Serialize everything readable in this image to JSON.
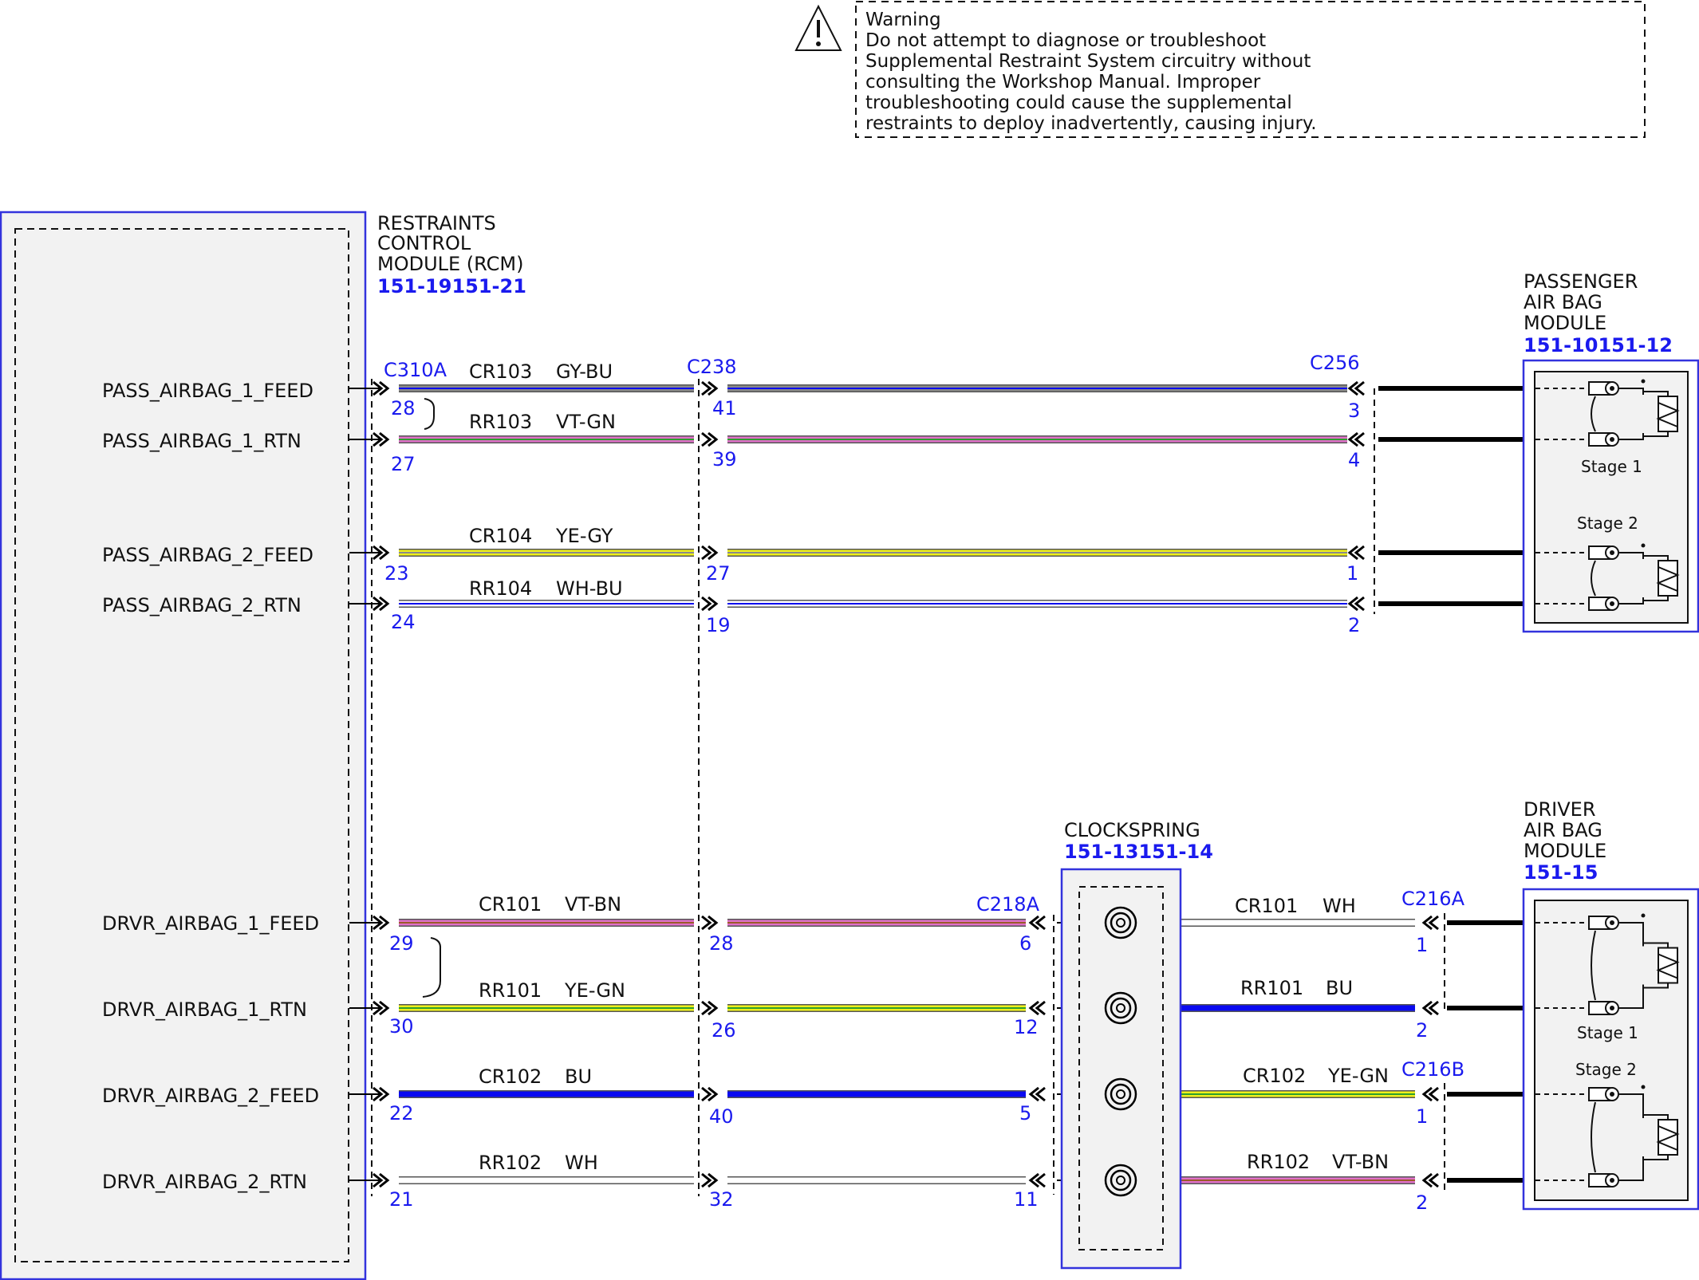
{
  "warning": {
    "title": "Warning",
    "lines": [
      "Do not attempt to diagnose or troubleshoot",
      "Supplemental Restraint System circuitry without",
      "consulting the Workshop Manual. Improper",
      "troubleshooting could cause the supplemental",
      "restraints to deploy inadvertently, causing injury."
    ],
    "icon": "warning-triangle-icon"
  },
  "rcm": {
    "name_lines": [
      "RESTRAINTS",
      "CONTROL",
      "MODULE (RCM)"
    ],
    "ref": "151-19151-21",
    "pins": [
      "PASS_AIRBAG_1_FEED",
      "PASS_AIRBAG_1_RTN",
      "PASS_AIRBAG_2_FEED",
      "PASS_AIRBAG_2_RTN",
      "DRVR_AIRBAG_1_FEED",
      "DRVR_AIRBAG_1_RTN",
      "DRVR_AIRBAG_2_FEED",
      "DRVR_AIRBAG_2_RTN"
    ]
  },
  "connectors": {
    "c310a": "C310A",
    "c238": "C238",
    "c256": "C256",
    "c218a": "C218A",
    "c216a": "C216A",
    "c216b": "C216B"
  },
  "circuits": [
    {
      "id": "CR103",
      "color": "GY-BU"
    },
    {
      "id": "RR103",
      "color": "VT-GN"
    },
    {
      "id": "CR104",
      "color": "YE-GY"
    },
    {
      "id": "RR104",
      "color": "WH-BU"
    },
    {
      "id": "CR101",
      "color": "VT-BN"
    },
    {
      "id": "RR101",
      "color": "YE-GN"
    },
    {
      "id": "CR102",
      "color": "BU"
    },
    {
      "id": "RR102",
      "color": "WH"
    }
  ],
  "clockspring_side": [
    "WH",
    "BU",
    "YE-GN",
    "VT-BN"
  ],
  "pins": [
    "28",
    "41",
    "3",
    "27",
    "39",
    "4",
    "23",
    "27",
    "1",
    "24",
    "19",
    "2",
    "29",
    "28",
    "6",
    "1",
    "30",
    "26",
    "12",
    "2",
    "22",
    "40",
    "5",
    "1",
    "21",
    "32",
    "11",
    "2"
  ],
  "clockspring": {
    "name": "CLOCKSPRING",
    "ref": "151-13151-14"
  },
  "passenger": {
    "name_lines": [
      "PASSENGER",
      "AIR BAG",
      "MODULE"
    ],
    "ref": "151-10151-12",
    "stage1": "Stage 1",
    "stage2": "Stage 2"
  },
  "driver": {
    "name_lines": [
      "DRIVER",
      "AIR BAG",
      "MODULE"
    ],
    "ref": "151-15",
    "stage1": "Stage 1",
    "stage2": "Stage 2"
  },
  "colors": {
    "module_border": "#3333dd",
    "reference_text": "#1a1aee",
    "module_fill": "#f2f2f2",
    "wire_gray": "#8a8a8a",
    "wire_blue": "#0a0af0",
    "wire_violet": "#e070c8",
    "wire_yellow": "#eef01a",
    "wire_green": "#2e9e2e",
    "wire_white": "#ffffff",
    "wire_brown": "#9a5a2a"
  }
}
